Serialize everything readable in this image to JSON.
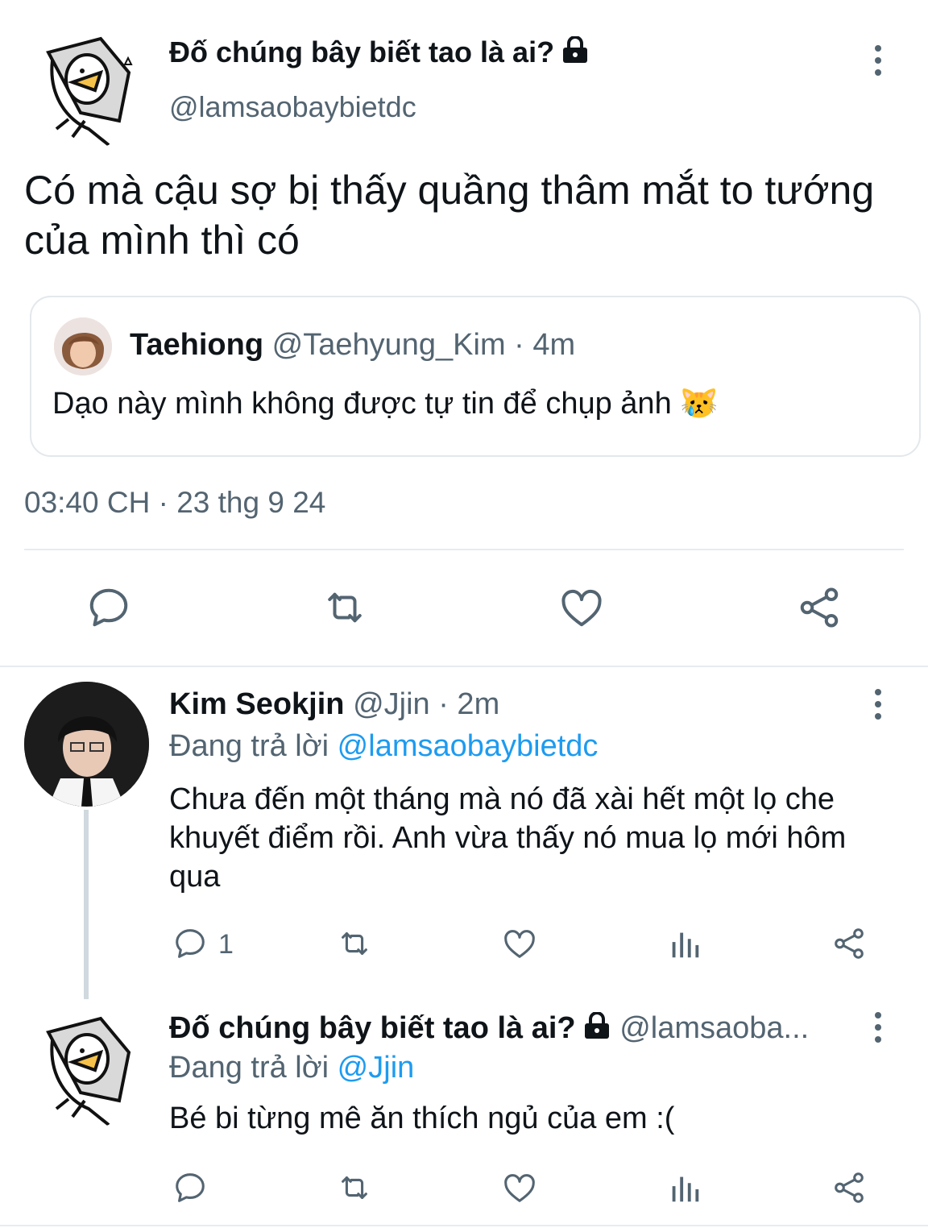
{
  "main_tweet": {
    "display_name": "Đố chúng bây biết tao là ai?",
    "handle": "@lamsaobaybietdc",
    "text": "Có mà cậu sợ bị thấy quầng thâm mắt to tướng của mình thì có",
    "quoted": {
      "name": "Taehiong",
      "handle": "@Taehyung_Kim",
      "time": "· 4m",
      "text": "Dạo này mình không được tự tin để chụp ảnh 😿"
    },
    "timestamp": "03:40 CH · 23 thg 9 24"
  },
  "replies": [
    {
      "name": "Kim Seokjin",
      "handle": "@Jjin",
      "time": "· 2m",
      "replying_prefix": "Đang trả lời",
      "replying_to": "@lamsaobaybietdc",
      "text": "Chưa đến một tháng mà nó đã xài hết một lọ che khuyết điểm rồi. Anh vừa thấy nó mua lọ mới hôm qua",
      "reply_count": "1"
    },
    {
      "name": "Đố chúng bây biết tao là ai?",
      "handle": "@lamsaoba...",
      "replying_prefix": "Đang trả lời",
      "replying_to": "@Jjin",
      "text": "Bé bi từng mê ăn thích ngủ của em :("
    }
  ],
  "colors": {
    "text": "#0f1419",
    "muted": "#536471",
    "link": "#1d9bf0",
    "divider": "#e6ecf0"
  },
  "icons": [
    "reply-icon",
    "retweet-icon",
    "like-icon",
    "share-icon",
    "views-icon",
    "more-icon",
    "lock-icon"
  ]
}
